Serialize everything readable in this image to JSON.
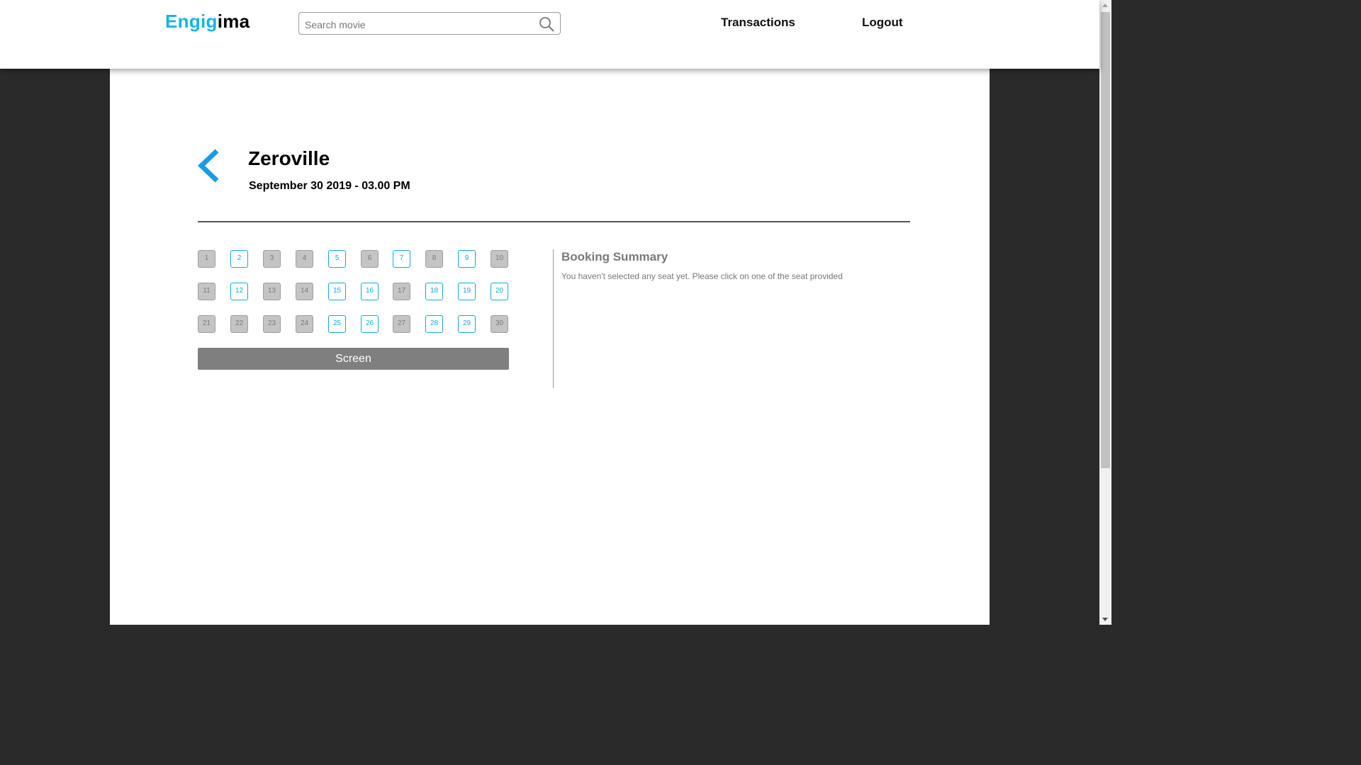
{
  "header": {
    "logo": {
      "part1": "Eng",
      "part2": "i",
      "part3": "g",
      "part4": "i",
      "part5": "ma"
    },
    "search": {
      "placeholder": "Search movie",
      "value": ""
    },
    "nav": {
      "transactions": "Transactions",
      "logout": "Logout"
    }
  },
  "movie": {
    "title": "Zeroville",
    "datetime": "September 30 2019 - 03.00 PM"
  },
  "seats": [
    {
      "n": "1",
      "available": false
    },
    {
      "n": "2",
      "available": true
    },
    {
      "n": "3",
      "available": false
    },
    {
      "n": "4",
      "available": false
    },
    {
      "n": "5",
      "available": true
    },
    {
      "n": "6",
      "available": false
    },
    {
      "n": "7",
      "available": true
    },
    {
      "n": "8",
      "available": false
    },
    {
      "n": "9",
      "available": true
    },
    {
      "n": "10",
      "available": false
    },
    {
      "n": "11",
      "available": false
    },
    {
      "n": "12",
      "available": true
    },
    {
      "n": "13",
      "available": false
    },
    {
      "n": "14",
      "available": false
    },
    {
      "n": "15",
      "available": true
    },
    {
      "n": "16",
      "available": true
    },
    {
      "n": "17",
      "available": false
    },
    {
      "n": "18",
      "available": true
    },
    {
      "n": "19",
      "available": true
    },
    {
      "n": "20",
      "available": true
    },
    {
      "n": "21",
      "available": false
    },
    {
      "n": "22",
      "available": false
    },
    {
      "n": "23",
      "available": false
    },
    {
      "n": "24",
      "available": false
    },
    {
      "n": "25",
      "available": true
    },
    {
      "n": "26",
      "available": true
    },
    {
      "n": "27",
      "available": false
    },
    {
      "n": "28",
      "available": true
    },
    {
      "n": "29",
      "available": true
    },
    {
      "n": "30",
      "available": false
    }
  ],
  "screen_label": "Screen",
  "summary": {
    "title": "Booking Summary",
    "message": "You haven't selected any seat yet. Please click on one of the seat provided"
  },
  "colors": {
    "accent": "#12b5e5",
    "seat_available": "#12a8e0",
    "seat_taken": "#c4c4c4",
    "screen": "#7f7f7f",
    "outer_background": "#2a2a2a"
  },
  "icons": {
    "search": "search-icon",
    "back": "chevron-left-icon"
  }
}
